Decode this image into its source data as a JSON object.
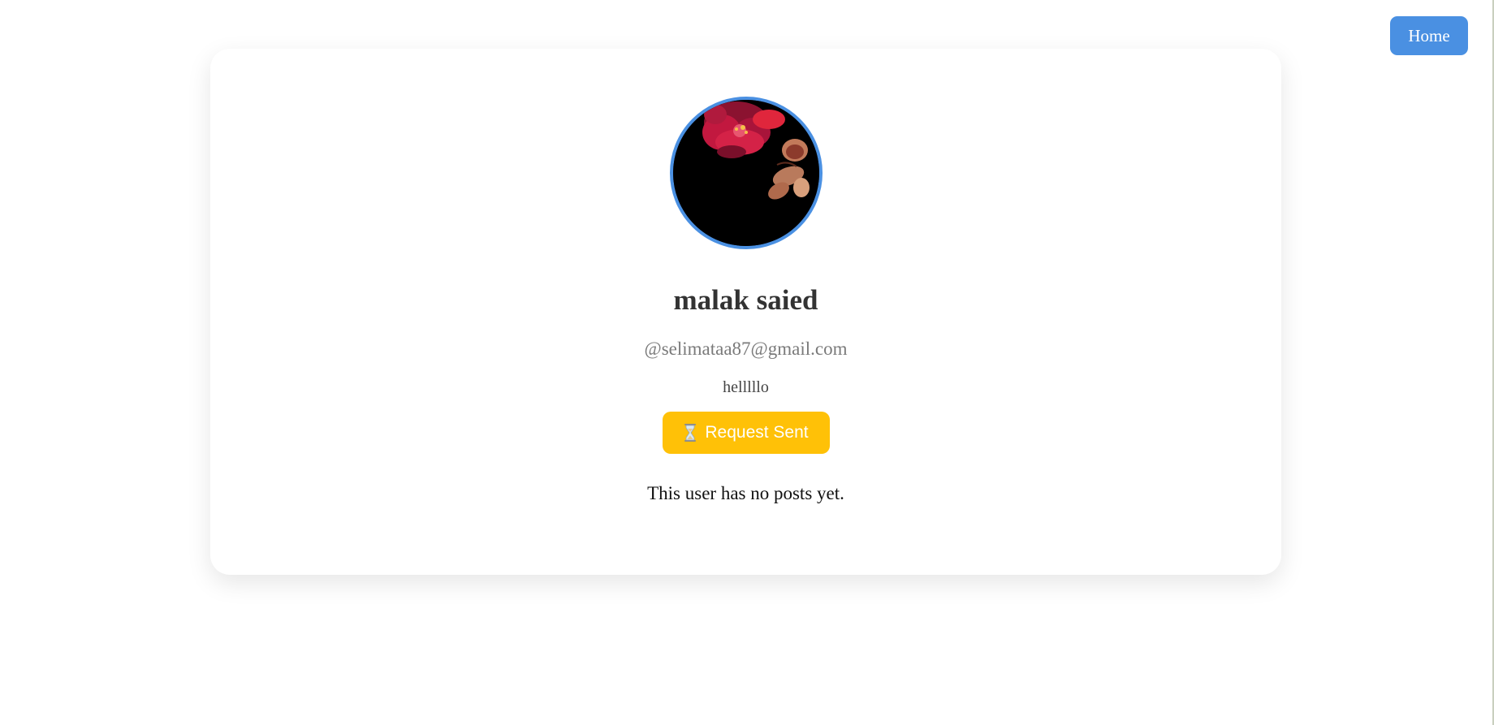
{
  "nav": {
    "home_label": "Home"
  },
  "profile": {
    "avatar_icon": "flower-photo",
    "name": "malak saied",
    "handle": "@selimataa87@gmail.com",
    "bio": "helllllo",
    "request_button_icon": "hourglass-icon",
    "request_button_label": "Request Sent",
    "empty_posts_text": "This user has no posts yet."
  },
  "colors": {
    "accent": "#4a90e2",
    "request_button": "#ffc107",
    "name_text": "#333333",
    "handle_text": "#7a7a7a"
  }
}
